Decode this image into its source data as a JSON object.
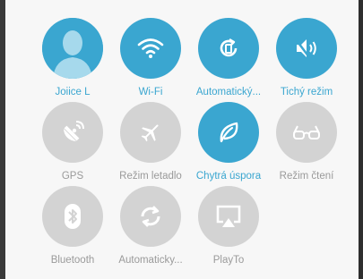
{
  "colors": {
    "active": "#3aa6d0",
    "inactive": "#d3d3d3",
    "active_text": "#3aa6d0",
    "inactive_text": "#9a9a9a"
  },
  "tiles": [
    {
      "label": "Joiice L",
      "icon": "user-avatar-icon",
      "active": true
    },
    {
      "label": "Wi-Fi",
      "icon": "wifi-icon",
      "active": true
    },
    {
      "label": "Automatický...",
      "icon": "auto-rotate-icon",
      "active": true
    },
    {
      "label": "Tichý režim",
      "icon": "silent-mode-icon",
      "active": true
    },
    {
      "label": "GPS",
      "icon": "gps-icon",
      "active": false
    },
    {
      "label": "Režim letadlo",
      "icon": "airplane-icon",
      "active": false
    },
    {
      "label": "Chytrá úspora",
      "icon": "leaf-icon",
      "active": true
    },
    {
      "label": "Režim čtení",
      "icon": "glasses-icon",
      "active": false
    },
    {
      "label": "Bluetooth",
      "icon": "bluetooth-icon",
      "active": false
    },
    {
      "label": "Automaticky...",
      "icon": "sync-icon",
      "active": false
    },
    {
      "label": "PlayTo",
      "icon": "playto-icon",
      "active": false
    }
  ]
}
